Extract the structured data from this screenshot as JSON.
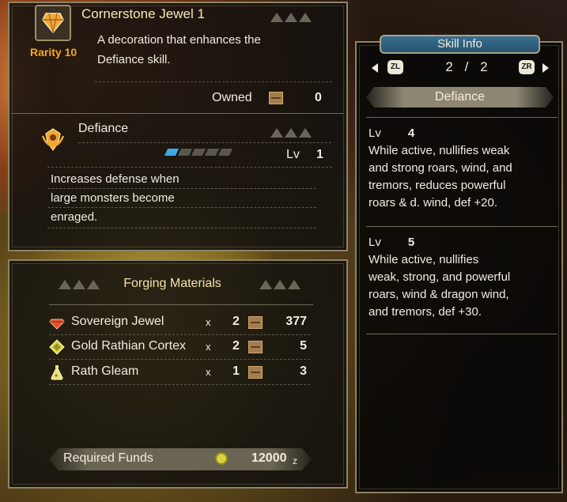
{
  "jewel": {
    "name": "Cornerstone Jewel 1",
    "rarity_label": "Rarity 10",
    "description": "A decoration that enhances the Defiance skill.",
    "description_line1": "A decoration that enhances the",
    "description_line2": "Defiance skill.",
    "owned_label": "Owned",
    "owned_value": "0"
  },
  "skill": {
    "name": "Defiance",
    "level_label": "Lv",
    "level_value": "1",
    "level_filled": 1,
    "level_max": 5,
    "description": "Increases defense when large monsters become enraged.",
    "desc_line1": "Increases defense when",
    "desc_line2": "large monsters become",
    "desc_line3": "enraged."
  },
  "forging": {
    "header": "Forging Materials",
    "materials": [
      {
        "name": "Sovereign Jewel",
        "x": "x",
        "qty": "2",
        "owned": "377",
        "icon": "gem-icon",
        "color": "#e2502a"
      },
      {
        "name": "Gold Rathian Cortex",
        "x": "x",
        "qty": "2",
        "owned": "5",
        "icon": "scale-icon",
        "color": "#d8d452"
      },
      {
        "name": "Rath Gleam",
        "x": "x",
        "qty": "1",
        "owned": "3",
        "icon": "flask-icon",
        "color": "#e8e07a"
      }
    ],
    "funds_label": "Required Funds",
    "funds_value": "12000",
    "funds_unit": "z"
  },
  "skill_info": {
    "title": "Skill Info",
    "left_key": "ZL",
    "right_key": "ZR",
    "page_current": "2",
    "page_sep": "/",
    "page_total": "2",
    "skill_tab": "Defiance",
    "levels": [
      {
        "label": "Lv",
        "value": "4",
        "lines": [
          "While active, nullifies weak",
          "and strong roars, wind, and",
          "tremors, reduces powerful",
          "roars & d. wind, def +20."
        ]
      },
      {
        "label": "Lv",
        "value": "5",
        "lines": [
          "While active, nullifies",
          "weak, strong, and powerful",
          "roars, wind & dragon wind,",
          "and tremors, def +30."
        ]
      }
    ]
  },
  "colors": {
    "rarity": "#f5a623",
    "level_on": "#3fa9e8",
    "panel_border": "#8d8466",
    "skill_info_title_bg": "#2f6584"
  }
}
